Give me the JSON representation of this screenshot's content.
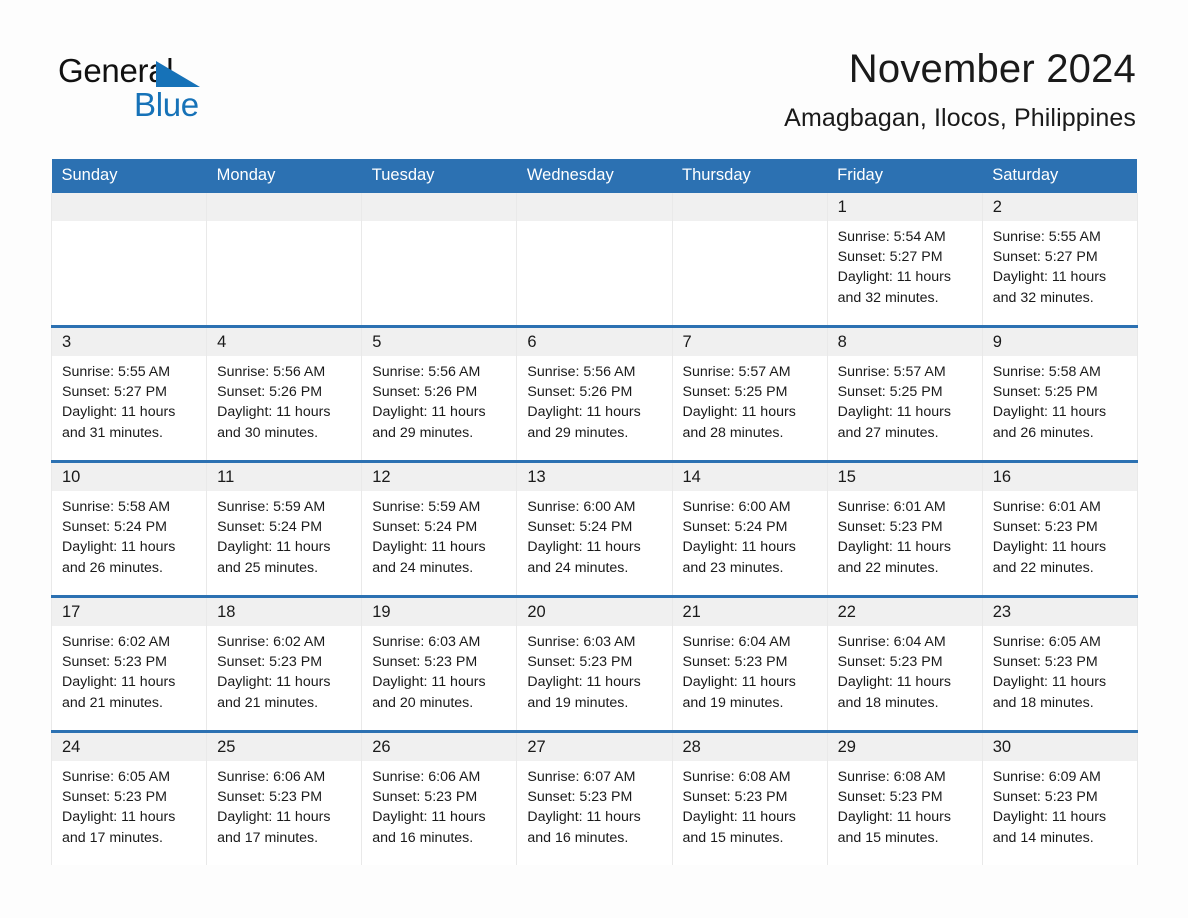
{
  "brand": {
    "name_part1": "General",
    "name_part2": "Blue",
    "triangle_color": "#1672b8"
  },
  "header": {
    "month_title": "November 2024",
    "location": "Amagbagan, Ilocos, Philippines"
  },
  "colors": {
    "header_blue": "#2c71b2",
    "row_divider_blue": "#2c71b2",
    "daynum_background": "#f0f0f0",
    "brand_blue": "#1672b8"
  },
  "weekday_headers": [
    "Sunday",
    "Monday",
    "Tuesday",
    "Wednesday",
    "Thursday",
    "Friday",
    "Saturday"
  ],
  "weeks": [
    [
      {
        "day": "",
        "sunrise": "",
        "sunset": "",
        "daylight": ""
      },
      {
        "day": "",
        "sunrise": "",
        "sunset": "",
        "daylight": ""
      },
      {
        "day": "",
        "sunrise": "",
        "sunset": "",
        "daylight": ""
      },
      {
        "day": "",
        "sunrise": "",
        "sunset": "",
        "daylight": ""
      },
      {
        "day": "",
        "sunrise": "",
        "sunset": "",
        "daylight": ""
      },
      {
        "day": "1",
        "sunrise": "Sunrise: 5:54 AM",
        "sunset": "Sunset: 5:27 PM",
        "daylight": "Daylight: 11 hours and 32 minutes."
      },
      {
        "day": "2",
        "sunrise": "Sunrise: 5:55 AM",
        "sunset": "Sunset: 5:27 PM",
        "daylight": "Daylight: 11 hours and 32 minutes."
      }
    ],
    [
      {
        "day": "3",
        "sunrise": "Sunrise: 5:55 AM",
        "sunset": "Sunset: 5:27 PM",
        "daylight": "Daylight: 11 hours and 31 minutes."
      },
      {
        "day": "4",
        "sunrise": "Sunrise: 5:56 AM",
        "sunset": "Sunset: 5:26 PM",
        "daylight": "Daylight: 11 hours and 30 minutes."
      },
      {
        "day": "5",
        "sunrise": "Sunrise: 5:56 AM",
        "sunset": "Sunset: 5:26 PM",
        "daylight": "Daylight: 11 hours and 29 minutes."
      },
      {
        "day": "6",
        "sunrise": "Sunrise: 5:56 AM",
        "sunset": "Sunset: 5:26 PM",
        "daylight": "Daylight: 11 hours and 29 minutes."
      },
      {
        "day": "7",
        "sunrise": "Sunrise: 5:57 AM",
        "sunset": "Sunset: 5:25 PM",
        "daylight": "Daylight: 11 hours and 28 minutes."
      },
      {
        "day": "8",
        "sunrise": "Sunrise: 5:57 AM",
        "sunset": "Sunset: 5:25 PM",
        "daylight": "Daylight: 11 hours and 27 minutes."
      },
      {
        "day": "9",
        "sunrise": "Sunrise: 5:58 AM",
        "sunset": "Sunset: 5:25 PM",
        "daylight": "Daylight: 11 hours and 26 minutes."
      }
    ],
    [
      {
        "day": "10",
        "sunrise": "Sunrise: 5:58 AM",
        "sunset": "Sunset: 5:24 PM",
        "daylight": "Daylight: 11 hours and 26 minutes."
      },
      {
        "day": "11",
        "sunrise": "Sunrise: 5:59 AM",
        "sunset": "Sunset: 5:24 PM",
        "daylight": "Daylight: 11 hours and 25 minutes."
      },
      {
        "day": "12",
        "sunrise": "Sunrise: 5:59 AM",
        "sunset": "Sunset: 5:24 PM",
        "daylight": "Daylight: 11 hours and 24 minutes."
      },
      {
        "day": "13",
        "sunrise": "Sunrise: 6:00 AM",
        "sunset": "Sunset: 5:24 PM",
        "daylight": "Daylight: 11 hours and 24 minutes."
      },
      {
        "day": "14",
        "sunrise": "Sunrise: 6:00 AM",
        "sunset": "Sunset: 5:24 PM",
        "daylight": "Daylight: 11 hours and 23 minutes."
      },
      {
        "day": "15",
        "sunrise": "Sunrise: 6:01 AM",
        "sunset": "Sunset: 5:23 PM",
        "daylight": "Daylight: 11 hours and 22 minutes."
      },
      {
        "day": "16",
        "sunrise": "Sunrise: 6:01 AM",
        "sunset": "Sunset: 5:23 PM",
        "daylight": "Daylight: 11 hours and 22 minutes."
      }
    ],
    [
      {
        "day": "17",
        "sunrise": "Sunrise: 6:02 AM",
        "sunset": "Sunset: 5:23 PM",
        "daylight": "Daylight: 11 hours and 21 minutes."
      },
      {
        "day": "18",
        "sunrise": "Sunrise: 6:02 AM",
        "sunset": "Sunset: 5:23 PM",
        "daylight": "Daylight: 11 hours and 21 minutes."
      },
      {
        "day": "19",
        "sunrise": "Sunrise: 6:03 AM",
        "sunset": "Sunset: 5:23 PM",
        "daylight": "Daylight: 11 hours and 20 minutes."
      },
      {
        "day": "20",
        "sunrise": "Sunrise: 6:03 AM",
        "sunset": "Sunset: 5:23 PM",
        "daylight": "Daylight: 11 hours and 19 minutes."
      },
      {
        "day": "21",
        "sunrise": "Sunrise: 6:04 AM",
        "sunset": "Sunset: 5:23 PM",
        "daylight": "Daylight: 11 hours and 19 minutes."
      },
      {
        "day": "22",
        "sunrise": "Sunrise: 6:04 AM",
        "sunset": "Sunset: 5:23 PM",
        "daylight": "Daylight: 11 hours and 18 minutes."
      },
      {
        "day": "23",
        "sunrise": "Sunrise: 6:05 AM",
        "sunset": "Sunset: 5:23 PM",
        "daylight": "Daylight: 11 hours and 18 minutes."
      }
    ],
    [
      {
        "day": "24",
        "sunrise": "Sunrise: 6:05 AM",
        "sunset": "Sunset: 5:23 PM",
        "daylight": "Daylight: 11 hours and 17 minutes."
      },
      {
        "day": "25",
        "sunrise": "Sunrise: 6:06 AM",
        "sunset": "Sunset: 5:23 PM",
        "daylight": "Daylight: 11 hours and 17 minutes."
      },
      {
        "day": "26",
        "sunrise": "Sunrise: 6:06 AM",
        "sunset": "Sunset: 5:23 PM",
        "daylight": "Daylight: 11 hours and 16 minutes."
      },
      {
        "day": "27",
        "sunrise": "Sunrise: 6:07 AM",
        "sunset": "Sunset: 5:23 PM",
        "daylight": "Daylight: 11 hours and 16 minutes."
      },
      {
        "day": "28",
        "sunrise": "Sunrise: 6:08 AM",
        "sunset": "Sunset: 5:23 PM",
        "daylight": "Daylight: 11 hours and 15 minutes."
      },
      {
        "day": "29",
        "sunrise": "Sunrise: 6:08 AM",
        "sunset": "Sunset: 5:23 PM",
        "daylight": "Daylight: 11 hours and 15 minutes."
      },
      {
        "day": "30",
        "sunrise": "Sunrise: 6:09 AM",
        "sunset": "Sunset: 5:23 PM",
        "daylight": "Daylight: 11 hours and 14 minutes."
      }
    ]
  ]
}
